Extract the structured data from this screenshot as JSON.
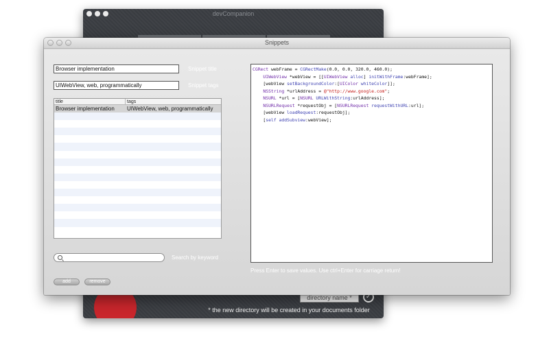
{
  "background_window": {
    "title": "devCompanion",
    "directory_field_placeholder": "directory name *",
    "note": "* the new directory will be created in your documents folder"
  },
  "window": {
    "title": "Snippets"
  },
  "form": {
    "snippet_title_value": "Browser implementation",
    "snippet_title_label": "Snippet title",
    "snippet_tags_value": "UIWebView, web, programmatically",
    "snippet_tags_label": "Snippet tags"
  },
  "table": {
    "columns": [
      "title",
      "tags"
    ],
    "rows": [
      {
        "title": "Browser implementation",
        "tags": "UIWebView, web, programmatically",
        "selected": true
      }
    ],
    "empty_rows": 16
  },
  "search": {
    "placeholder": "",
    "label": "Search by keyword"
  },
  "code": {
    "lines": [
      [
        {
          "t": "type",
          "v": "CGRect"
        },
        {
          "t": "plain",
          "v": " webFrame = "
        },
        {
          "t": "fn",
          "v": "CGRectMake"
        },
        {
          "t": "plain",
          "v": "(0.0, 0.0, 320.0, 460.0);"
        }
      ],
      [
        {
          "t": "plain",
          "v": "    "
        },
        {
          "t": "type",
          "v": "UIWebView"
        },
        {
          "t": "plain",
          "v": " *webView = [["
        },
        {
          "t": "type",
          "v": "UIWebView"
        },
        {
          "t": "plain",
          "v": " "
        },
        {
          "t": "fn",
          "v": "alloc"
        },
        {
          "t": "plain",
          "v": "] "
        },
        {
          "t": "fn",
          "v": "initWithFrame"
        },
        {
          "t": "plain",
          "v": ":webFrame];"
        }
      ],
      [
        {
          "t": "plain",
          "v": "    [webView "
        },
        {
          "t": "fn",
          "v": "setBackgroundColor"
        },
        {
          "t": "plain",
          "v": ":["
        },
        {
          "t": "type",
          "v": "UIColor"
        },
        {
          "t": "plain",
          "v": " "
        },
        {
          "t": "fn",
          "v": "whiteColor"
        },
        {
          "t": "plain",
          "v": "]];"
        }
      ],
      [
        {
          "t": "plain",
          "v": "    "
        },
        {
          "t": "type",
          "v": "NSString"
        },
        {
          "t": "plain",
          "v": " *urlAddress = "
        },
        {
          "t": "str",
          "v": "@\"http://www.google.com\""
        },
        {
          "t": "plain",
          "v": ";"
        }
      ],
      [
        {
          "t": "plain",
          "v": "    "
        },
        {
          "t": "type",
          "v": "NSURL"
        },
        {
          "t": "plain",
          "v": " *url = ["
        },
        {
          "t": "type",
          "v": "NSURL"
        },
        {
          "t": "plain",
          "v": " "
        },
        {
          "t": "fn",
          "v": "URLWithString"
        },
        {
          "t": "plain",
          "v": ":urlAddress];"
        }
      ],
      [
        {
          "t": "plain",
          "v": "    "
        },
        {
          "t": "type",
          "v": "NSURLRequest"
        },
        {
          "t": "plain",
          "v": " *requestObj = ["
        },
        {
          "t": "type",
          "v": "NSURLRequest"
        },
        {
          "t": "plain",
          "v": " "
        },
        {
          "t": "fn",
          "v": "requestWithURL"
        },
        {
          "t": "plain",
          "v": ":url];"
        }
      ],
      [
        {
          "t": "plain",
          "v": "    [webView "
        },
        {
          "t": "fn",
          "v": "loadRequest"
        },
        {
          "t": "plain",
          "v": ":requestObj];"
        }
      ],
      [
        {
          "t": "plain",
          "v": "    ["
        },
        {
          "t": "fn",
          "v": "self"
        },
        {
          "t": "plain",
          "v": " "
        },
        {
          "t": "fn",
          "v": "addSubview"
        },
        {
          "t": "plain",
          "v": ":webView];"
        }
      ]
    ]
  },
  "hint": "Press Enter to save values. Use ctrl+Enter for carriage return!",
  "buttons": {
    "add": "add",
    "remove": "remove"
  },
  "colors": {
    "accent_red": "#c9262c",
    "dark_background": "#3b3e43",
    "syntax_type": "#6f2ba8",
    "syntax_function": "#3b3fb0",
    "syntax_string": "#c41a16"
  }
}
